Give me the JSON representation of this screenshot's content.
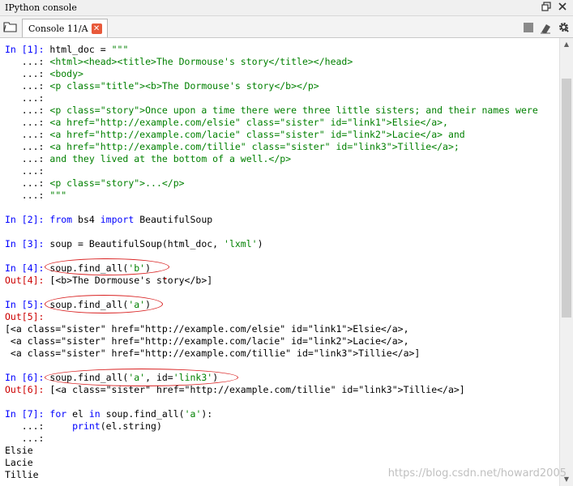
{
  "window": {
    "title": "IPython console"
  },
  "tab": {
    "label": "Console 11/A",
    "close_glyph": "✕"
  },
  "icons": {
    "undock": "undock-icon",
    "close_pane": "close-icon",
    "folder": "folder-icon",
    "stop": "stop-icon",
    "eraser": "eraser-icon",
    "gear": "gear-icon"
  },
  "colors": {
    "prompt_in": "#0000ff",
    "prompt_out": "#cc0000",
    "string": "#008000",
    "keyword": "#0000ff",
    "annotation": "#d92020"
  },
  "console": {
    "lines": [
      [
        [
          "pin",
          "In ["
        ],
        [
          "pin",
          "1"
        ],
        [
          "pin",
          "]: "
        ],
        [
          "",
          "html_doc = "
        ],
        [
          "str",
          "\"\"\""
        ]
      ],
      [
        [
          "",
          "   ...: "
        ],
        [
          "str",
          "<html><head><title>The Dormouse's story</title></head>"
        ]
      ],
      [
        [
          "",
          "   ...: "
        ],
        [
          "str",
          "<body>"
        ]
      ],
      [
        [
          "",
          "   ...: "
        ],
        [
          "str",
          "<p class=\"title\"><b>The Dormouse's story</b></p>"
        ]
      ],
      [
        [
          "",
          "   ...: "
        ]
      ],
      [
        [
          "",
          "   ...: "
        ],
        [
          "str",
          "<p class=\"story\">Once upon a time there were three little sisters; and their names were"
        ]
      ],
      [
        [
          "",
          "   ...: "
        ],
        [
          "str",
          "<a href=\"http://example.com/elsie\" class=\"sister\" id=\"link1\">Elsie</a>,"
        ]
      ],
      [
        [
          "",
          "   ...: "
        ],
        [
          "str",
          "<a href=\"http://example.com/lacie\" class=\"sister\" id=\"link2\">Lacie</a> and"
        ]
      ],
      [
        [
          "",
          "   ...: "
        ],
        [
          "str",
          "<a href=\"http://example.com/tillie\" class=\"sister\" id=\"link3\">Tillie</a>;"
        ]
      ],
      [
        [
          "",
          "   ...: "
        ],
        [
          "str",
          "and they lived at the bottom of a well.</p>"
        ]
      ],
      [
        [
          "",
          "   ...: "
        ]
      ],
      [
        [
          "",
          "   ...: "
        ],
        [
          "str",
          "<p class=\"story\">...</p>"
        ]
      ],
      [
        [
          "",
          "   ...: "
        ],
        [
          "str",
          "\"\"\""
        ]
      ],
      [],
      [
        [
          "pin",
          "In [2]: "
        ],
        [
          "kw",
          "from"
        ],
        [
          "",
          " bs4 "
        ],
        [
          "kw",
          "import"
        ],
        [
          "",
          " BeautifulSoup"
        ]
      ],
      [],
      [
        [
          "pin",
          "In [3]: "
        ],
        [
          "",
          "soup = BeautifulSoup(html_doc, "
        ],
        [
          "str",
          "'lxml'"
        ],
        [
          "",
          ")"
        ]
      ],
      [],
      [
        [
          "pin",
          "In [4]: "
        ],
        [
          "",
          "soup.find_all("
        ],
        [
          "str",
          "'b'"
        ],
        [
          "",
          ")"
        ]
      ],
      [
        [
          "pout",
          "Out[4]: "
        ],
        [
          "",
          "[<b>The Dormouse's story</b>]"
        ]
      ],
      [],
      [
        [
          "pin",
          "In [5]: "
        ],
        [
          "",
          "soup.find_all("
        ],
        [
          "str",
          "'a'"
        ],
        [
          "",
          ")"
        ]
      ],
      [
        [
          "pout",
          "Out[5]: "
        ]
      ],
      [
        [
          "",
          "[<a class=\"sister\" href=\"http://example.com/elsie\" id=\"link1\">Elsie</a>,"
        ]
      ],
      [
        [
          "",
          " <a class=\"sister\" href=\"http://example.com/lacie\" id=\"link2\">Lacie</a>,"
        ]
      ],
      [
        [
          "",
          " <a class=\"sister\" href=\"http://example.com/tillie\" id=\"link3\">Tillie</a>]"
        ]
      ],
      [],
      [
        [
          "pin",
          "In [6]: "
        ],
        [
          "",
          "soup.find_all("
        ],
        [
          "str",
          "'a'"
        ],
        [
          "",
          ", id="
        ],
        [
          "str",
          "'link3'"
        ],
        [
          "",
          ")"
        ]
      ],
      [
        [
          "pout",
          "Out[6]: "
        ],
        [
          "",
          "[<a class=\"sister\" href=\"http://example.com/tillie\" id=\"link3\">Tillie</a>]"
        ]
      ],
      [],
      [
        [
          "pin",
          "In [7]: "
        ],
        [
          "kw",
          "for"
        ],
        [
          "",
          " el "
        ],
        [
          "kw",
          "in"
        ],
        [
          "",
          " soup.find_all("
        ],
        [
          "str",
          "'a'"
        ],
        [
          "",
          "):"
        ]
      ],
      [
        [
          "",
          "   ...:     "
        ],
        [
          "kw",
          "print"
        ],
        [
          "",
          "(el.string)"
        ]
      ],
      [
        [
          "",
          "   ...: "
        ]
      ],
      [
        [
          "",
          "Elsie"
        ]
      ],
      [
        [
          "",
          "Lacie"
        ]
      ],
      [
        [
          "",
          "Tillie"
        ]
      ]
    ]
  },
  "watermark": "https://blog.csdn.net/howard2005"
}
